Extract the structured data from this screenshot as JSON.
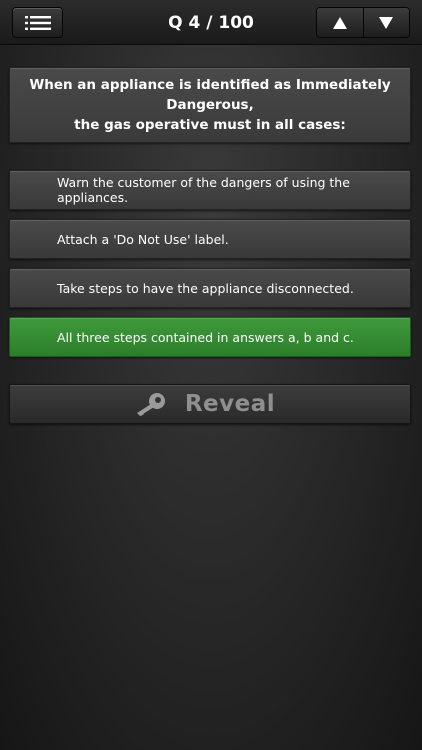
{
  "header": {
    "title": "Q 4 / 100",
    "menu_icon": "list-icon",
    "prev_icon": "up-triangle-icon",
    "next_icon": "down-triangle-icon"
  },
  "question": {
    "line1": "When an appliance is identified as Immediately Dangerous,",
    "line2": "the gas operative must in all cases:"
  },
  "answers": [
    {
      "label": "Warn the customer of the dangers of using the appliances."
    },
    {
      "label": "Attach a 'Do Not Use' label."
    },
    {
      "label": "Take steps to have the appliance disconnected."
    },
    {
      "label": "All three steps contained in answers a, b and c.",
      "state": "correct"
    }
  ],
  "reveal": {
    "label": "Reveal",
    "icon": "key-icon"
  },
  "colors": {
    "correct": "#3a9537",
    "background": "#2a2a2a",
    "panel": "#444444"
  }
}
